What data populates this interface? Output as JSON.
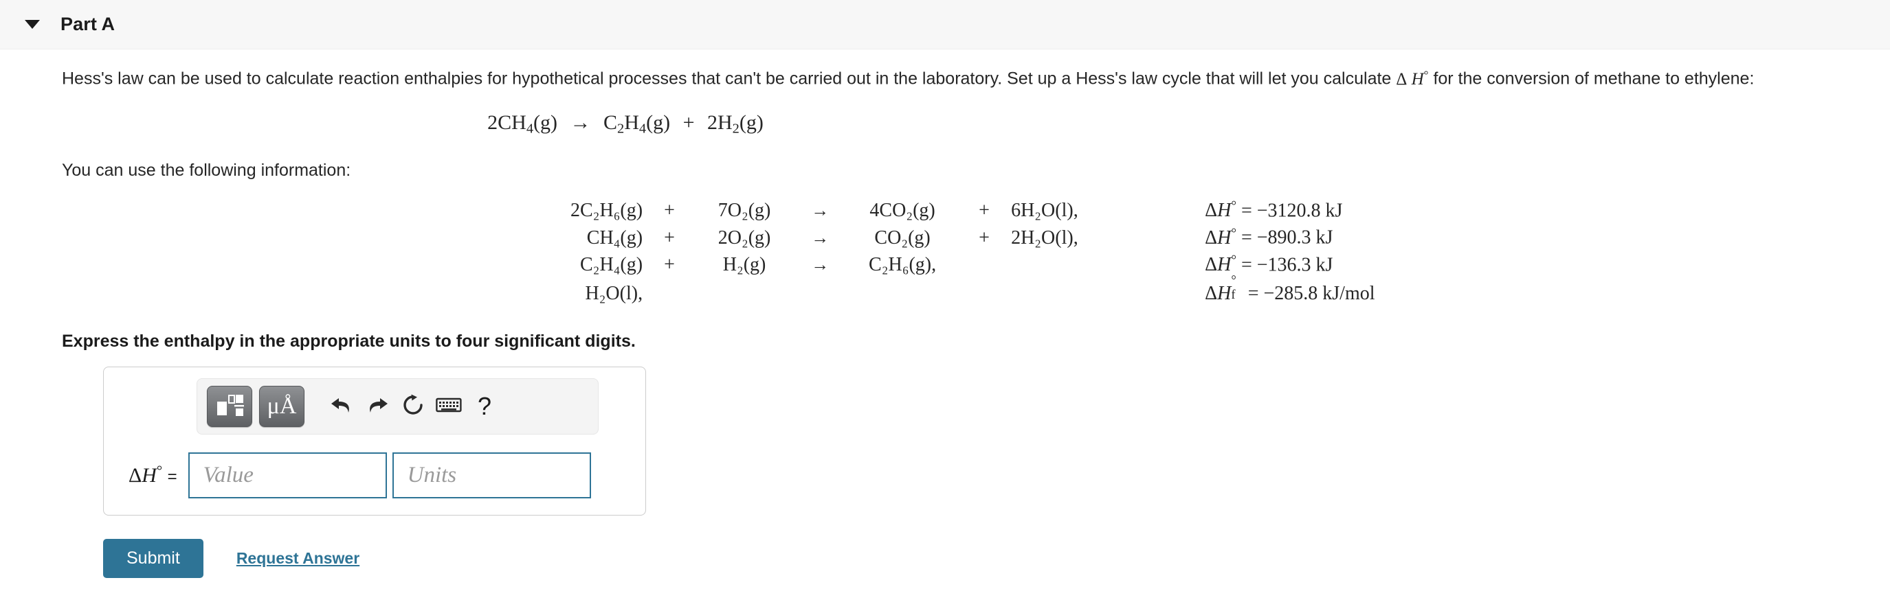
{
  "header": {
    "title": "Part A",
    "disclosure_icon": "triangle-down-icon"
  },
  "prompt": {
    "text_before_symbol": "Hess's law can be used to calculate reaction enthalpies for hypothetical processes that can't be carried out in the laboratory. Set up a Hess's law cycle that will let you calculate",
    "symbol": "Δ H°",
    "text_after_symbol": "for the conversion of methane to ethylene:",
    "info_label": "You can use the following information:",
    "instruction": "Express the enthalpy in the appropriate units to four significant digits."
  },
  "target_equation": {
    "reactant_coeff": "2",
    "reactant": "CH",
    "reactant_sub": "4",
    "reactant_state": "(g)",
    "arrow": "→",
    "product1": "C",
    "product1_sub1": "2",
    "product1_b": "H",
    "product1_sub2": "4",
    "product1_state": "(g)",
    "plus": "+",
    "product2_coeff": "2",
    "product2": "H",
    "product2_sub": "2",
    "product2_state": "(g)"
  },
  "reactions": [
    {
      "reactant": "2C₂H₆(g)",
      "plus": "+",
      "oxidant": "7O₂(g)",
      "arrow": "→",
      "product": "4CO₂(g)",
      "plus2": "+",
      "water": "6H₂O(l),",
      "dh_label": "ΔH°",
      "dh_value": "= −3120.8 kJ"
    },
    {
      "reactant": "CH₄(g)",
      "plus": "+",
      "oxidant": "2O₂(g)",
      "arrow": "→",
      "product": "CO₂(g)",
      "plus2": "+",
      "water": "2H₂O(l),",
      "dh_label": "ΔH°",
      "dh_value": "= −890.3 kJ"
    },
    {
      "reactant": "C₂H₄(g)",
      "plus": "+",
      "oxidant": "H₂(g)",
      "arrow": "→",
      "product": "C₂H₆(g),",
      "plus2": "",
      "water": "",
      "dh_label": "ΔH°",
      "dh_value": "= −136.3 kJ"
    },
    {
      "reactant": "H₂O(l),",
      "plus": "",
      "oxidant": "",
      "arrow": "",
      "product": "",
      "plus2": "",
      "water": "",
      "dh_label": "ΔH°f",
      "dh_value": "= −285.8 kJ/mol"
    }
  ],
  "answer_panel": {
    "toolbar": {
      "buttons": [
        {
          "name": "template-math-button",
          "icon": "math-template-icon",
          "label": ""
        },
        {
          "name": "units-button",
          "icon": "micro-angstrom-icon",
          "label": "μÅ"
        },
        {
          "name": "undo-button",
          "icon": "undo-arrow-icon",
          "label": ""
        },
        {
          "name": "redo-button",
          "icon": "redo-arrow-icon",
          "label": ""
        },
        {
          "name": "reset-button",
          "icon": "reset-circular-arrow-icon",
          "label": ""
        },
        {
          "name": "keyboard-button",
          "icon": "keyboard-icon",
          "label": ""
        },
        {
          "name": "help-button",
          "icon": "question-mark-icon",
          "label": "?"
        }
      ]
    },
    "field_label": "ΔH°",
    "field_equals": "=",
    "value_placeholder": "Value",
    "units_placeholder": "Units",
    "value_current": "",
    "units_current": ""
  },
  "footer": {
    "submit_label": "Submit",
    "request_answer_label": "Request Answer"
  },
  "colors": {
    "accent": "#2e7496",
    "header_bg": "#f7f7f7",
    "text": "#262626",
    "placeholder": "#9a9a9a"
  }
}
